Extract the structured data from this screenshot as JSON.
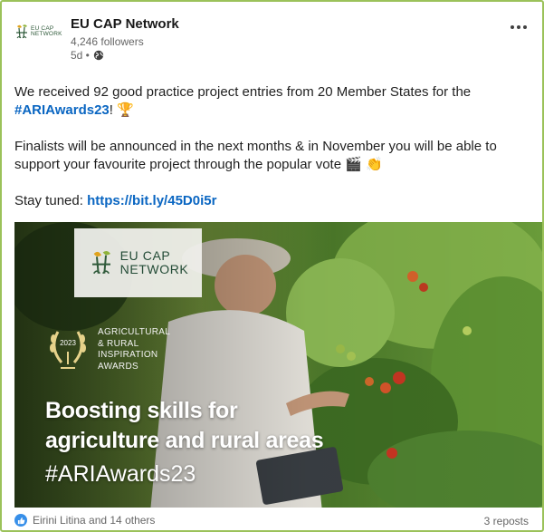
{
  "post": {
    "author": {
      "name": "EU CAP Network",
      "logo_text": "EU CAP NETWORK",
      "followers": "4,246 followers",
      "age": "5d •",
      "visibility_icon": "globe-icon"
    },
    "more_icon": "more-horizontal-icon",
    "text": {
      "line1": "We received 92 good practice project entries from 20 Member States for the",
      "hashtag": "#ARIAwards23",
      "hashtag_suffix": "!",
      "trophy_icon": "🏆",
      "paragraph2": "Finalists will be announced in the next months & in November you will be able to support your favourite project through the popular vote",
      "paragraph2_icons": "🎬 👏",
      "stay_tuned_label": "Stay tuned:",
      "link": "https://bit.ly/45D0i5r"
    },
    "image": {
      "badge_line1": "EU CAP",
      "badge_line2": "NETWORK",
      "awards_year": "2023",
      "awards_line1": "AGRICULTURAL",
      "awards_line2": "& RURAL",
      "awards_line3": "INSPIRATION",
      "awards_line4": "AWARDS",
      "headline_line1": "Boosting skills for",
      "headline_line2": "agriculture and rural areas",
      "hashtag": "#ARIAwards23"
    },
    "footer": {
      "reactions": "Eirini Litina and 14 others",
      "reposts": "3 reposts",
      "reaction_icon": "like-icon"
    }
  },
  "colors": {
    "card_border": "#9bc25a",
    "link": "#0a66c2",
    "like": "#378fe9"
  }
}
